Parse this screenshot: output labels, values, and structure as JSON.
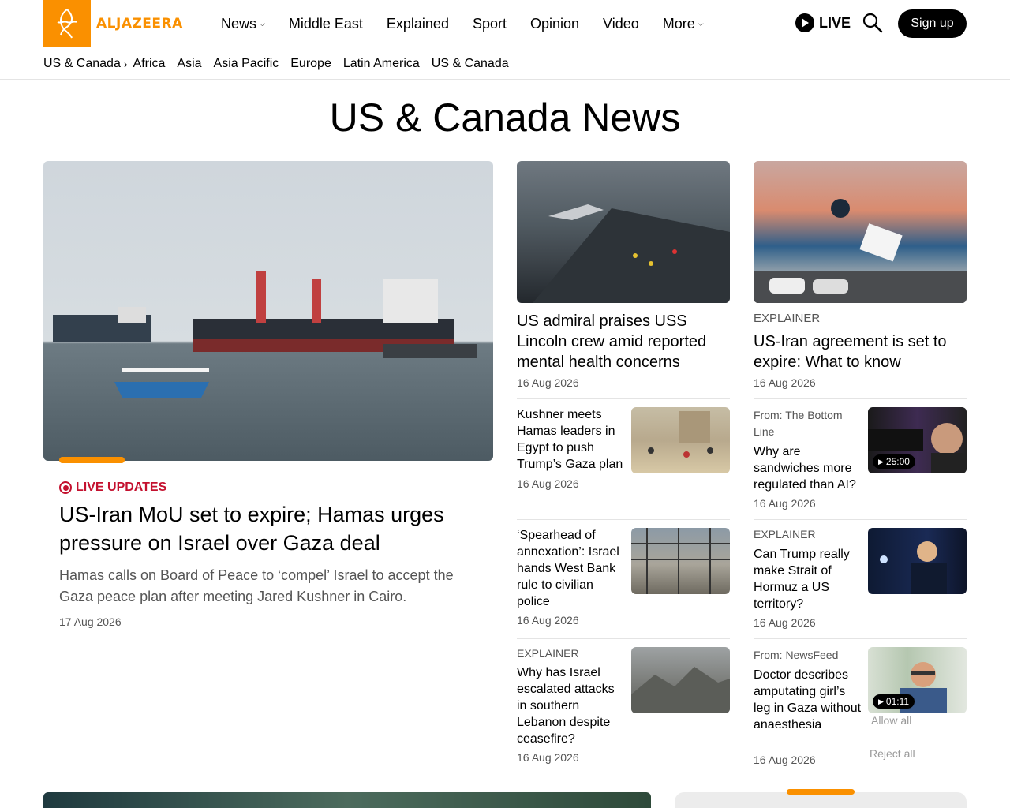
{
  "brand": {
    "logo_text": "ALJAZEERA",
    "accent": "#fa9000"
  },
  "nav": {
    "items": [
      {
        "label": "News",
        "dropdown": true
      },
      {
        "label": "Middle East",
        "dropdown": false
      },
      {
        "label": "Explained",
        "dropdown": false
      },
      {
        "label": "Sport",
        "dropdown": false
      },
      {
        "label": "Opinion",
        "dropdown": false
      },
      {
        "label": "Video",
        "dropdown": false
      },
      {
        "label": "More",
        "dropdown": true
      }
    ],
    "live_label": "LIVE",
    "signup_label": "Sign up"
  },
  "subnav": {
    "current": "US & Canada",
    "items": [
      "Africa",
      "Asia",
      "Asia Pacific",
      "Europe",
      "Latin America",
      "US & Canada"
    ]
  },
  "page_title": "US & Canada News",
  "lead": {
    "live_label": "LIVE UPDATES",
    "title": "US-Iran MoU set to expire; Hamas urges pressure on Israel over Gaza deal",
    "summary": "Hamas calls on Board of Peace to ‘compel’ Israel to accept the Gaza peace plan after meeting Jared Kushner in Cairo.",
    "date": "17 Aug 2026"
  },
  "top_cards": [
    {
      "kicker": "",
      "title": "US admiral praises USS Lincoln crew amid reported mental health concerns",
      "date": "16 Aug 2026"
    },
    {
      "kicker": "EXPLAINER",
      "title": "US-Iran agreement is set to expire: What to know",
      "date": "16 Aug 2026"
    }
  ],
  "col1": [
    {
      "kicker": "",
      "title": "Kushner meets Hamas leaders in Egypt to push Trump’s Gaza plan",
      "date": "16 Aug 2026"
    },
    {
      "kicker": "",
      "title": "‘Spearhead of annexation’: Israel hands West Bank rule to civilian police",
      "date": "16 Aug 2026"
    },
    {
      "kicker": "EXPLAINER",
      "title": "Why has Israel escalated attacks in southern Lebanon despite ceasefire?",
      "date": "16 Aug 2026"
    }
  ],
  "col2": [
    {
      "from": "From: The Bottom Line",
      "title": "Why are sandwiches more regulated than AI?",
      "date": "16 Aug 2026",
      "duration": "25:00"
    },
    {
      "kicker": "EXPLAINER",
      "title": "Can Trump really make Strait of Hormuz a US territory?",
      "date": "16 Aug 2026"
    },
    {
      "from": "From: NewsFeed",
      "title": "Doctor describes amputating girl’s leg in Gaza without anaesthesia",
      "date": "16 Aug 2026",
      "duration": "01:11"
    }
  ],
  "cookie": {
    "allow": "Allow all",
    "reject": "Reject all"
  },
  "icons": [
    "logo-icon",
    "chevron-down-icon",
    "play-icon",
    "search-icon",
    "chevron-right-icon",
    "live-icon"
  ]
}
